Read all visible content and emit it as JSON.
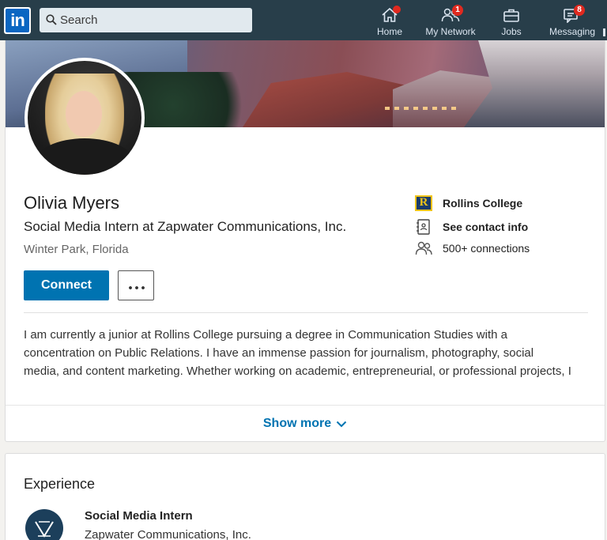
{
  "nav": {
    "search_placeholder": "Search",
    "items": [
      {
        "label": "Home",
        "icon": "home-icon",
        "badge": ""
      },
      {
        "label": "My Network",
        "icon": "people-icon",
        "badge": "1"
      },
      {
        "label": "Jobs",
        "icon": "briefcase-icon",
        "badge": ""
      },
      {
        "label": "Messaging",
        "icon": "messaging-icon",
        "badge": "8"
      }
    ]
  },
  "profile": {
    "name": "Olivia Myers",
    "headline": "Social Media Intern at Zapwater Communications, Inc.",
    "location": "Winter Park, Florida",
    "connect_label": "Connect",
    "school": "Rollins College",
    "contact_label": "See contact info",
    "connections": "500+ connections",
    "summary_lines": [
      "I am currently a junior at Rollins College pursuing a degree in Communication Studies with a",
      "concentration on Public Relations. I have an immense passion for journalism, photography, social",
      "media, and content marketing. Whether working on academic, entrepreneurial, or professional projects, I"
    ],
    "show_more_label": "Show more"
  },
  "experience": {
    "title": "Experience",
    "role": "Social Media Intern",
    "company": "Zapwater Communications, Inc."
  },
  "colors": {
    "nav_bg": "#283e4a",
    "brand_blue": "#0073b1",
    "badge_red": "#e0291f"
  }
}
